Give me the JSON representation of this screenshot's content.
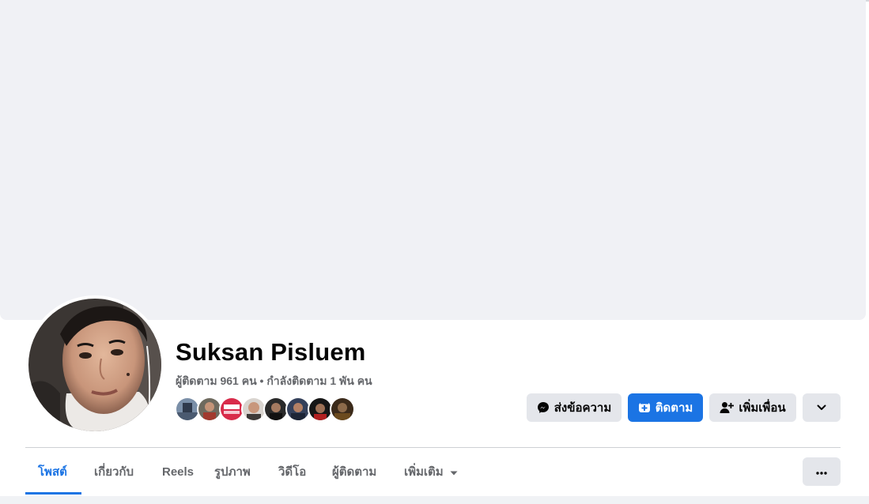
{
  "profile": {
    "name": "Suksan Pisluem",
    "stats": "ผู้ติดตาม 961 คน • กำลังติดตาม 1 พัน คน"
  },
  "actions": {
    "message_label": "ส่งข้อความ",
    "follow_label": "ติดตาม",
    "add_friend_label": "เพิ่มเพื่อน"
  },
  "tabs": [
    {
      "label": "โพสต์",
      "active": true
    },
    {
      "label": "เกี่ยวกับ",
      "active": false
    },
    {
      "label": "Reels",
      "active": false
    },
    {
      "label": "รูปภาพ",
      "active": false
    },
    {
      "label": "วิดีโอ",
      "active": false
    },
    {
      "label": "ผู้ติดตาม",
      "active": false
    },
    {
      "label": "เพิ่มเติม",
      "active": false
    }
  ],
  "colors": {
    "accent": "#1b74e4",
    "button_grey": "#e4e6eb",
    "cover": "#f0f1f5",
    "muted_text": "#65676b"
  },
  "icons": {
    "message": "messenger-icon",
    "follow": "follow-icon",
    "add_friend": "add-friend-icon",
    "dropdown": "chevron-down-icon",
    "more": "more-dots-icon",
    "tab_more": "caret-down-icon"
  }
}
